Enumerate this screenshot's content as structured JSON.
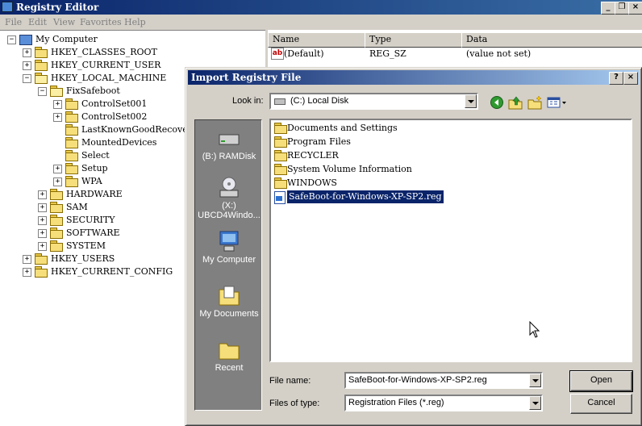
{
  "main_window": {
    "title": "Registry Editor",
    "menu": [
      "File",
      "Edit",
      "View",
      "Favorites",
      "Help"
    ]
  },
  "tree": {
    "items": [
      {
        "label": "My Computer",
        "expander": "−"
      },
      {
        "label": "HKEY_CLASSES_ROOT",
        "expander": "+"
      },
      {
        "label": "HKEY_CURRENT_USER",
        "expander": "+"
      },
      {
        "label": "HKEY_LOCAL_MACHINE",
        "expander": "−"
      },
      {
        "label": "FixSafeboot",
        "expander": "−"
      },
      {
        "label": "ControlSet001",
        "expander": "+"
      },
      {
        "label": "ControlSet002",
        "expander": "+"
      },
      {
        "label": "LastKnownGoodRecovery",
        "expander": ""
      },
      {
        "label": "MountedDevices",
        "expander": ""
      },
      {
        "label": "Select",
        "expander": ""
      },
      {
        "label": "Setup",
        "expander": "+"
      },
      {
        "label": "WPA",
        "expander": "+"
      },
      {
        "label": "HARDWARE",
        "expander": "+"
      },
      {
        "label": "SAM",
        "expander": "+"
      },
      {
        "label": "SECURITY",
        "expander": "+"
      },
      {
        "label": "SOFTWARE",
        "expander": "+"
      },
      {
        "label": "SYSTEM",
        "expander": "+"
      },
      {
        "label": "HKEY_USERS",
        "expander": "+"
      },
      {
        "label": "HKEY_CURRENT_CONFIG",
        "expander": "+"
      }
    ]
  },
  "list": {
    "columns": [
      "Name",
      "Type",
      "Data"
    ],
    "rows": [
      {
        "name": "(Default)",
        "type": "REG_SZ",
        "data": "(value not set)",
        "icon": "ab"
      }
    ]
  },
  "dialog": {
    "title": "Import Registry File",
    "look_in_label": "Look in:",
    "look_in_value": "(C:) Local Disk",
    "places": [
      {
        "label": "(B:) RAMDisk",
        "icon": "drive-icon"
      },
      {
        "label": "(X:) UBCD4Windo...",
        "icon": "cd-drive-icon"
      },
      {
        "label": "My Computer",
        "icon": "computer-icon"
      },
      {
        "label": "My Documents",
        "icon": "documents-icon"
      },
      {
        "label": "Recent",
        "icon": "recent-icon"
      }
    ],
    "files": [
      {
        "label": "Documents and Settings",
        "kind": "folder"
      },
      {
        "label": "Program Files",
        "kind": "folder"
      },
      {
        "label": "RECYCLER",
        "kind": "folder"
      },
      {
        "label": "System Volume Information",
        "kind": "folder"
      },
      {
        "label": "WINDOWS",
        "kind": "folder"
      },
      {
        "label": "SafeBoot-for-Windows-XP-SP2.reg",
        "kind": "reg",
        "selected": true
      }
    ],
    "file_name_label": "File name:",
    "file_name_value": "SafeBoot-for-Windows-XP-SP2.reg",
    "file_type_label": "Files of type:",
    "file_type_value": "Registration Files (*.reg)",
    "open_label": "Open",
    "cancel_label": "Cancel",
    "help_glyph": "?",
    "close_glyph": "×"
  }
}
